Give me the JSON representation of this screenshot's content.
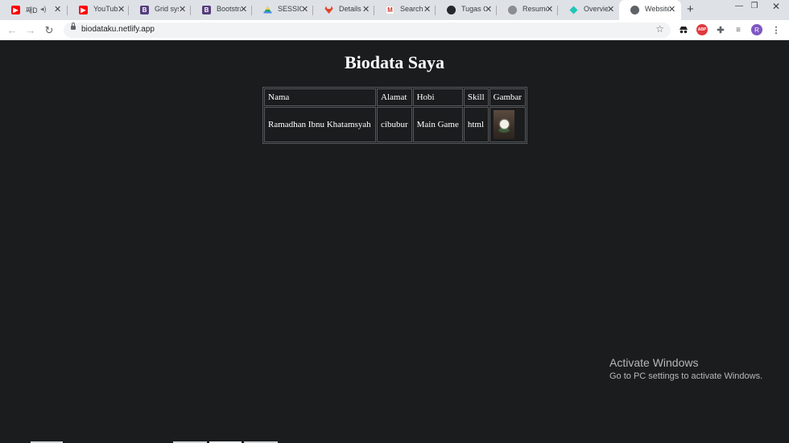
{
  "browser": {
    "tabs": [
      {
        "title": "째D",
        "favicon": "youtube-icon",
        "color": "#ff0000"
      },
      {
        "title": "YouTube",
        "favicon": "youtube-icon",
        "color": "#ff0000"
      },
      {
        "title": "Grid sys",
        "favicon": "bootstrap-icon",
        "color": "#563d7c"
      },
      {
        "title": "Bootstra",
        "favicon": "bootstrap-icon",
        "color": "#563d7c"
      },
      {
        "title": "SESSION",
        "favicon": "google-drive-icon",
        "color": "#1fa463"
      },
      {
        "title": "Details",
        "favicon": "gitlab-icon",
        "color": "#e24329"
      },
      {
        "title": "Search",
        "favicon": "gmail-icon",
        "color": "#d93025"
      },
      {
        "title": "Tugas C",
        "favicon": "github-icon",
        "color": "#24292e"
      },
      {
        "title": "Resume",
        "favicon": "globe-icon",
        "color": "#888888"
      },
      {
        "title": "Overvie",
        "favicon": "netlify-icon",
        "color": "#20c6b7"
      },
      {
        "title": "Website",
        "favicon": "globe-icon",
        "color": "#5f6368",
        "active": true
      }
    ],
    "url": "biodataku.netlify.app",
    "extensions": [
      "incognito-icon",
      "abp-icon",
      "puzzle-icon",
      "playlist-icon"
    ],
    "abp_label": "ABP",
    "profile_initial": "R"
  },
  "page": {
    "heading": "Biodata Saya",
    "table": {
      "headers": [
        "Nama",
        "Alamat",
        "Hobi",
        "Skill",
        "Gambar"
      ],
      "rows": [
        [
          "Ramadhan Ibnu Khatamsyah",
          "cibubur",
          "Main Game",
          "html"
        ]
      ]
    }
  },
  "watermark": {
    "line1": "Activate Windows",
    "line2": "Go to PC settings to activate Windows."
  }
}
